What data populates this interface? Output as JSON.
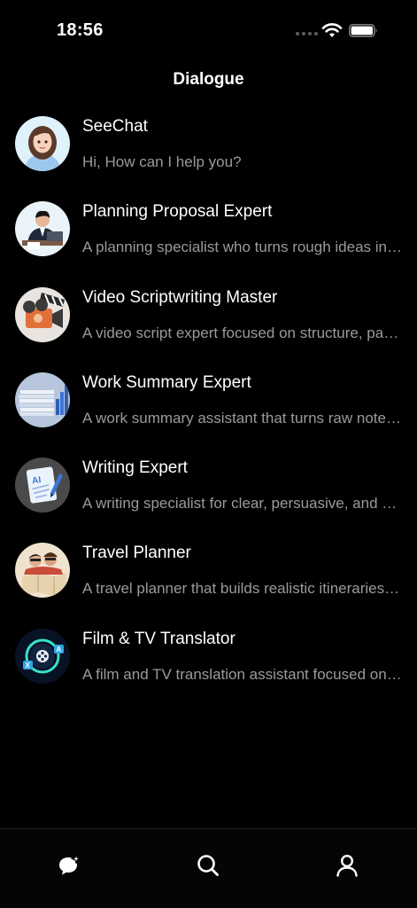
{
  "status": {
    "time": "18:56"
  },
  "header": {
    "title": "Dialogue"
  },
  "list": [
    {
      "title": "SeeChat",
      "subtitle": "Hi, How can I help you?",
      "icon": "woman-avatar-icon"
    },
    {
      "title": "Planning Proposal Expert",
      "subtitle": "A planning specialist who turns rough ideas into structured proposals.",
      "icon": "businessman-avatar-icon"
    },
    {
      "title": "Video Scriptwriting Master",
      "subtitle": "A video script expert focused on structure, pacing and hooks.",
      "icon": "film-camera-avatar-icon"
    },
    {
      "title": "Work Summary Expert",
      "subtitle": "A work summary assistant that turns raw notes into reports.",
      "icon": "documents-chart-avatar-icon"
    },
    {
      "title": "Writing Expert",
      "subtitle": "A writing specialist for clear, persuasive, and polished text.",
      "icon": "ai-writing-avatar-icon"
    },
    {
      "title": "Travel Planner",
      "subtitle": "A travel planner that builds realistic itineraries for any trip.",
      "icon": "travelers-avatar-icon"
    },
    {
      "title": "Film & TV Translator",
      "subtitle": "A film and TV translation assistant focused on natural subtitles.",
      "icon": "translation-avatar-icon"
    }
  ],
  "tabs": [
    {
      "name": "chat",
      "icon": "chat-bubble-sparkle-icon"
    },
    {
      "name": "search",
      "icon": "search-icon"
    },
    {
      "name": "profile",
      "icon": "person-icon"
    }
  ]
}
